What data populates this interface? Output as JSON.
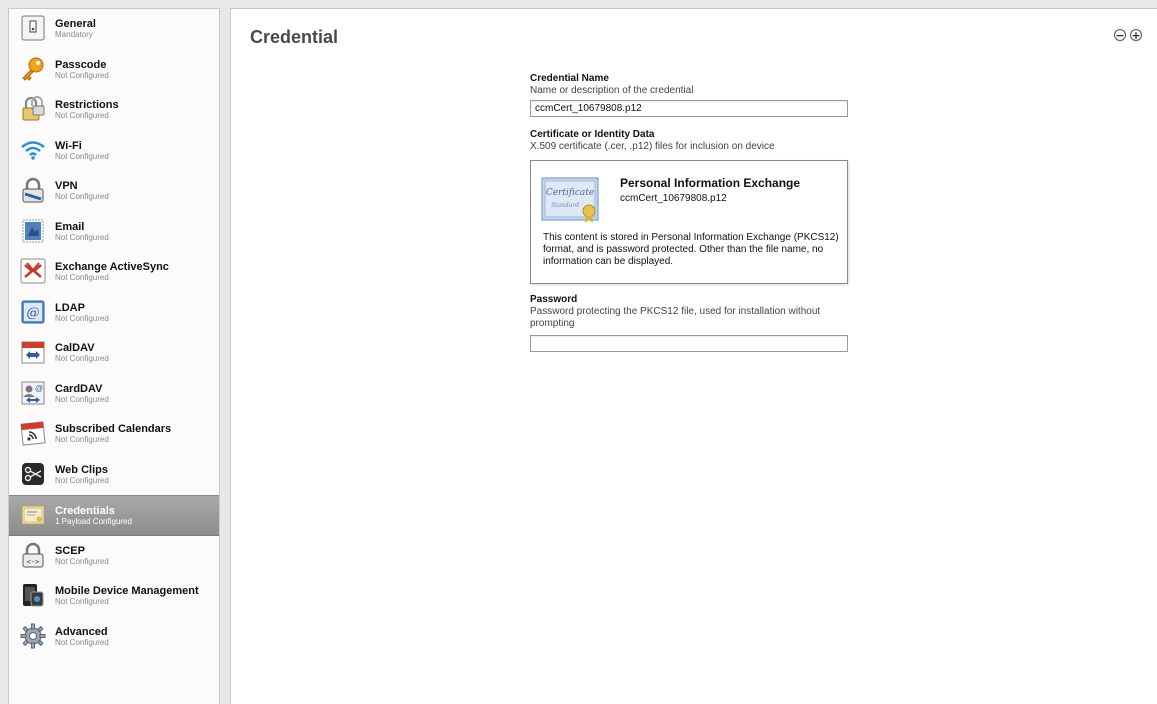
{
  "sidebar": {
    "items": [
      {
        "title": "General",
        "subtitle": "Mandatory",
        "icon": "general-icon"
      },
      {
        "title": "Passcode",
        "subtitle": "Not Configured",
        "icon": "key-icon"
      },
      {
        "title": "Restrictions",
        "subtitle": "Not Configured",
        "icon": "padlock-icon"
      },
      {
        "title": "Wi-Fi",
        "subtitle": "Not Configured",
        "icon": "wifi-icon"
      },
      {
        "title": "VPN",
        "subtitle": "Not Configured",
        "icon": "vpn-lock-icon"
      },
      {
        "title": "Email",
        "subtitle": "Not Configured",
        "icon": "email-stamp-icon"
      },
      {
        "title": "Exchange ActiveSync",
        "subtitle": "Not Configured",
        "icon": "exchange-icon"
      },
      {
        "title": "LDAP",
        "subtitle": "Not Configured",
        "icon": "ldap-at-icon"
      },
      {
        "title": "CalDAV",
        "subtitle": "Not Configured",
        "icon": "calendar-sync-icon"
      },
      {
        "title": "CardDAV",
        "subtitle": "Not Configured",
        "icon": "contacts-sync-icon"
      },
      {
        "title": "Subscribed Calendars",
        "subtitle": "Not Configured",
        "icon": "calendar-feed-icon"
      },
      {
        "title": "Web Clips",
        "subtitle": "Not Configured",
        "icon": "scissors-icon"
      },
      {
        "title": "Credentials",
        "subtitle": "1 Payload Configured",
        "icon": "certificate-icon",
        "selected": true
      },
      {
        "title": "SCEP",
        "subtitle": "Not Configured",
        "icon": "scep-lock-icon"
      },
      {
        "title": "Mobile Device Management",
        "subtitle": "Not Configured",
        "icon": "mdm-device-icon"
      },
      {
        "title": "Advanced",
        "subtitle": "Not Configured",
        "icon": "gear-icon"
      }
    ]
  },
  "main": {
    "title": "Credential",
    "remove_symbol": "−",
    "add_symbol": "+"
  },
  "form": {
    "name_label": "Credential Name",
    "name_desc": "Name or description of the credential",
    "name_value": "ccmCert_10679808.p12",
    "cert_label": "Certificate or Identity Data",
    "cert_desc": "X.509 certificate (.cer, .p12) files for inclusion on device",
    "cert_title": "Personal Information Exchange",
    "cert_file": "ccmCert_10679808.p12",
    "cert_note": "This content is stored in Personal Information Exchange (PKCS12) format, and is password protected.  Other than the file name, no information can be displayed.",
    "cert_icon_text": [
      "Certificate",
      "Standard"
    ],
    "password_label": "Password",
    "password_desc": "Password protecting the PKCS12 file, used for installation without prompting",
    "password_value": ""
  }
}
